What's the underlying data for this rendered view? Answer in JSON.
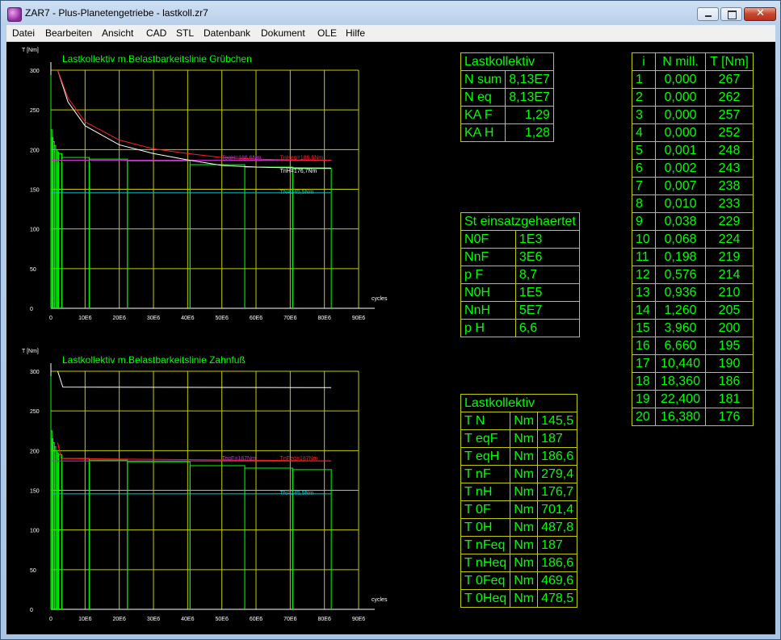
{
  "window": {
    "title": "ZAR7 - Plus-Planetengetriebe  -  lastkoll.zr7"
  },
  "menu": [
    "Datei",
    "Bearbeiten",
    "Ansicht",
    "CAD",
    "STL",
    "Datenbank",
    "Dokument",
    "OLE",
    "Hilfe"
  ],
  "charts": [
    {
      "title": "Lastkollektiv m.Belastbarkeitslinie Grübchen",
      "ylabel": "T [Nm]",
      "xlabel": "cycles",
      "yticks": [
        "0",
        "50",
        "100",
        "150",
        "200",
        "250",
        "300"
      ],
      "xticks": [
        "0",
        "10E6",
        "20E6",
        "30E6",
        "40E6",
        "50E6",
        "60E6",
        "70E6",
        "80E6",
        "90E6"
      ],
      "annotations": [
        "TeqH=186,6Nm",
        "TnHeq=186,6Nm",
        "TnH=176,7Nm",
        "TN=145,5Nm"
      ]
    },
    {
      "title": "Lastkollektiv m.Belastbarkeitslinie Zahnfuß",
      "ylabel": "T [Nm]",
      "xlabel": "cycles",
      "yticks": [
        "0",
        "50",
        "100",
        "150",
        "200",
        "250",
        "300"
      ],
      "xticks": [
        "0",
        "10E6",
        "20E6",
        "30E6",
        "40E6",
        "50E6",
        "60E6",
        "70E6",
        "80E6",
        "90E6"
      ],
      "annotations": [
        "TeqF=187Nm",
        "TnFeq=187Nm",
        "TN=145,5Nm"
      ]
    }
  ],
  "chart_data": [
    {
      "type": "line",
      "title": "Lastkollektiv m.Belastbarkeitslinie Grübchen",
      "xlabel": "cycles",
      "ylabel": "T [Nm]",
      "ylim": [
        0,
        300
      ],
      "xlim": [
        0,
        90000000
      ],
      "series": [
        {
          "name": "TeqH=186,6Nm",
          "x": [
            0,
            82000000
          ],
          "y": [
            186.6,
            186.6
          ]
        },
        {
          "name": "TN=145,5Nm",
          "x": [
            0,
            82000000
          ],
          "y": [
            145.5,
            145.5
          ]
        },
        {
          "name": "TnH=176,7Nm",
          "x": [
            2000000,
            5000000,
            10000000,
            20000000,
            30000000,
            40000000,
            50000000,
            60000000,
            70000000,
            82000000
          ],
          "y": [
            300,
            260,
            230,
            206,
            195,
            187,
            180,
            178,
            177,
            176.7
          ]
        },
        {
          "name": "TnHeq=186,6Nm",
          "x": [
            2000000,
            5000000,
            10000000,
            20000000,
            30000000,
            40000000,
            50000000,
            60000000,
            70000000,
            82000000
          ],
          "y": [
            300,
            265,
            235,
            212,
            201,
            195,
            190,
            188,
            187,
            186.6
          ]
        }
      ]
    },
    {
      "type": "line",
      "title": "Lastkollektiv m.Belastbarkeitslinie Zahnfuß",
      "xlabel": "cycles",
      "ylabel": "T [Nm]",
      "ylim": [
        0,
        300
      ],
      "xlim": [
        0,
        90000000
      ],
      "series": [
        {
          "name": "TeqF=187Nm",
          "x": [
            0,
            82000000
          ],
          "y": [
            187,
            187
          ]
        },
        {
          "name": "TN=145,5Nm",
          "x": [
            0,
            82000000
          ],
          "y": [
            145.5,
            145.5
          ]
        },
        {
          "name": "",
          "x": [
            2000000,
            3500000,
            82000000
          ],
          "y": [
            300,
            280,
            279.4
          ]
        }
      ]
    }
  ],
  "tables": {
    "lastkollektiv_top": {
      "header": "Lastkollektiv",
      "rows": [
        [
          "N sum",
          "8,13E7"
        ],
        [
          "N eq",
          "8,13E7"
        ],
        [
          "KA F",
          "1,29"
        ],
        [
          "KA H",
          "1,28"
        ]
      ]
    },
    "material": {
      "header": "St einsatzgehaertet",
      "rows": [
        [
          "N0F",
          "1E3"
        ],
        [
          "NnF",
          "3E6"
        ],
        [
          "p F",
          "8,7"
        ],
        [
          "N0H",
          "1E5"
        ],
        [
          "NnH",
          "5E7"
        ],
        [
          "p H",
          "6,6"
        ]
      ]
    },
    "lastkollektiv_bottom": {
      "header": "Lastkollektiv",
      "rows": [
        [
          "T N",
          "Nm",
          "145,5"
        ],
        [
          "T eqF",
          "Nm",
          "187"
        ],
        [
          "T eqH",
          "Nm",
          "186,6"
        ],
        [
          "T nF",
          "Nm",
          "279,4"
        ],
        [
          "T nH",
          "Nm",
          "176,7"
        ],
        [
          "T 0F",
          "Nm",
          "701,4"
        ],
        [
          "T 0H",
          "Nm",
          "487,8"
        ],
        [
          "T nFeq",
          "Nm",
          "187"
        ],
        [
          "T nHeq",
          "Nm",
          "186,6"
        ],
        [
          "T 0Feq",
          "Nm",
          "469,6"
        ],
        [
          "T 0Heq",
          "Nm",
          "478,5"
        ]
      ]
    },
    "spectrum": {
      "headers": [
        "i",
        "N mill.",
        "T [Nm]"
      ],
      "rows": [
        [
          "1",
          "0,000",
          "267"
        ],
        [
          "2",
          "0,000",
          "262"
        ],
        [
          "3",
          "0,000",
          "257"
        ],
        [
          "4",
          "0,000",
          "252"
        ],
        [
          "5",
          "0,001",
          "248"
        ],
        [
          "6",
          "0,002",
          "243"
        ],
        [
          "7",
          "0,007",
          "238"
        ],
        [
          "8",
          "0,010",
          "233"
        ],
        [
          "9",
          "0,038",
          "229"
        ],
        [
          "10",
          "0,068",
          "224"
        ],
        [
          "11",
          "0,198",
          "219"
        ],
        [
          "12",
          "0,576",
          "214"
        ],
        [
          "13",
          "0,936",
          "210"
        ],
        [
          "14",
          "1,260",
          "205"
        ],
        [
          "15",
          "3,960",
          "200"
        ],
        [
          "16",
          "6,660",
          "195"
        ],
        [
          "17",
          "10,440",
          "190"
        ],
        [
          "18",
          "18,360",
          "186"
        ],
        [
          "19",
          "22,400",
          "181"
        ],
        [
          "20",
          "16,380",
          "176"
        ]
      ]
    }
  },
  "colors": {
    "background": "#000000",
    "grid": "#c8c800",
    "text": "#00ff00",
    "equivalent": "#cc33cc",
    "nominal": "#00c8c8",
    "white_curve": "#ffffff",
    "red_curve": "#ff2020"
  }
}
